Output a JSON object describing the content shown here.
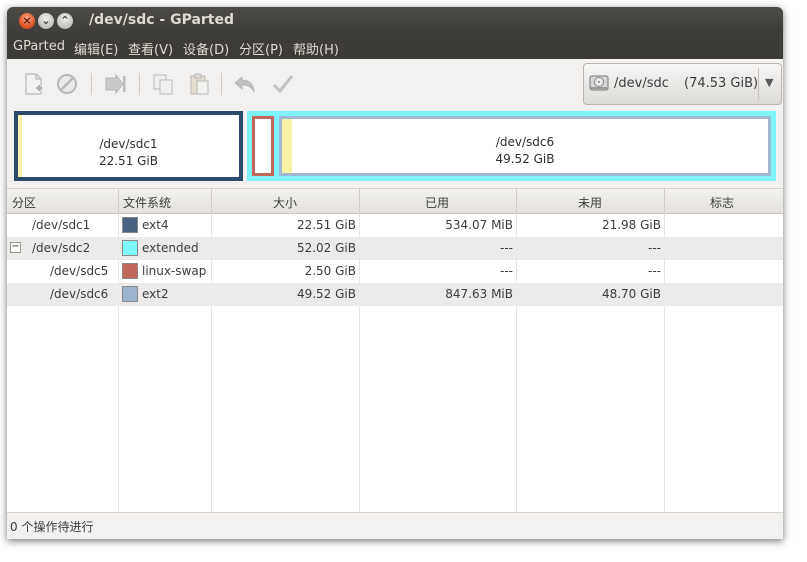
{
  "window": {
    "title": "/dev/sdc - GParted"
  },
  "menu": [
    "GParted",
    "编辑(E)",
    "查看(V)",
    "设备(D)",
    "分区(P)",
    "帮助(H)"
  ],
  "toolbar": {
    "icons": [
      "new-partition-icon",
      "delete-icon",
      "resize-move-icon",
      "copy-icon",
      "paste-icon",
      "undo-icon",
      "apply-icon"
    ],
    "device": {
      "name": "/dev/sdc",
      "size": "(74.53 GiB)"
    }
  },
  "diskmap": {
    "sdc1": {
      "name": "/dev/sdc1",
      "size": "22.51 GiB",
      "color": "#2e4a6b",
      "fill": 0.02
    },
    "sdc5": {
      "color": "#c4675a"
    },
    "sdc6": {
      "name": "/dev/sdc6",
      "size": "49.52 GiB",
      "color": "#a0b8d0",
      "fill": 0.02
    },
    "extended_color": "#7ef3f8"
  },
  "table": {
    "headers": [
      "分区",
      "文件系统",
      "大小",
      "已用",
      "未用",
      "标志"
    ],
    "rows": [
      {
        "partition": "/dev/sdc1",
        "fs": "ext4",
        "color": "#4a6180",
        "size": "22.51 GiB",
        "used": "534.07 MiB",
        "unused": "21.98 GiB",
        "flags": ""
      },
      {
        "partition": "/dev/sdc2",
        "fs": "extended",
        "color": "#7ffbfb",
        "size": "52.02 GiB",
        "used": "---",
        "unused": "---",
        "flags": "",
        "expander": "−"
      },
      {
        "partition": "/dev/sdc5",
        "fs": "linux-swap",
        "color": "#c1665a",
        "size": "2.50 GiB",
        "used": "---",
        "unused": "---",
        "flags": ""
      },
      {
        "partition": "/dev/sdc6",
        "fs": "ext2",
        "color": "#9db3cb",
        "size": "49.52 GiB",
        "used": "847.63 MiB",
        "unused": "48.70 GiB",
        "flags": ""
      }
    ]
  },
  "status": "0 个操作待进行"
}
